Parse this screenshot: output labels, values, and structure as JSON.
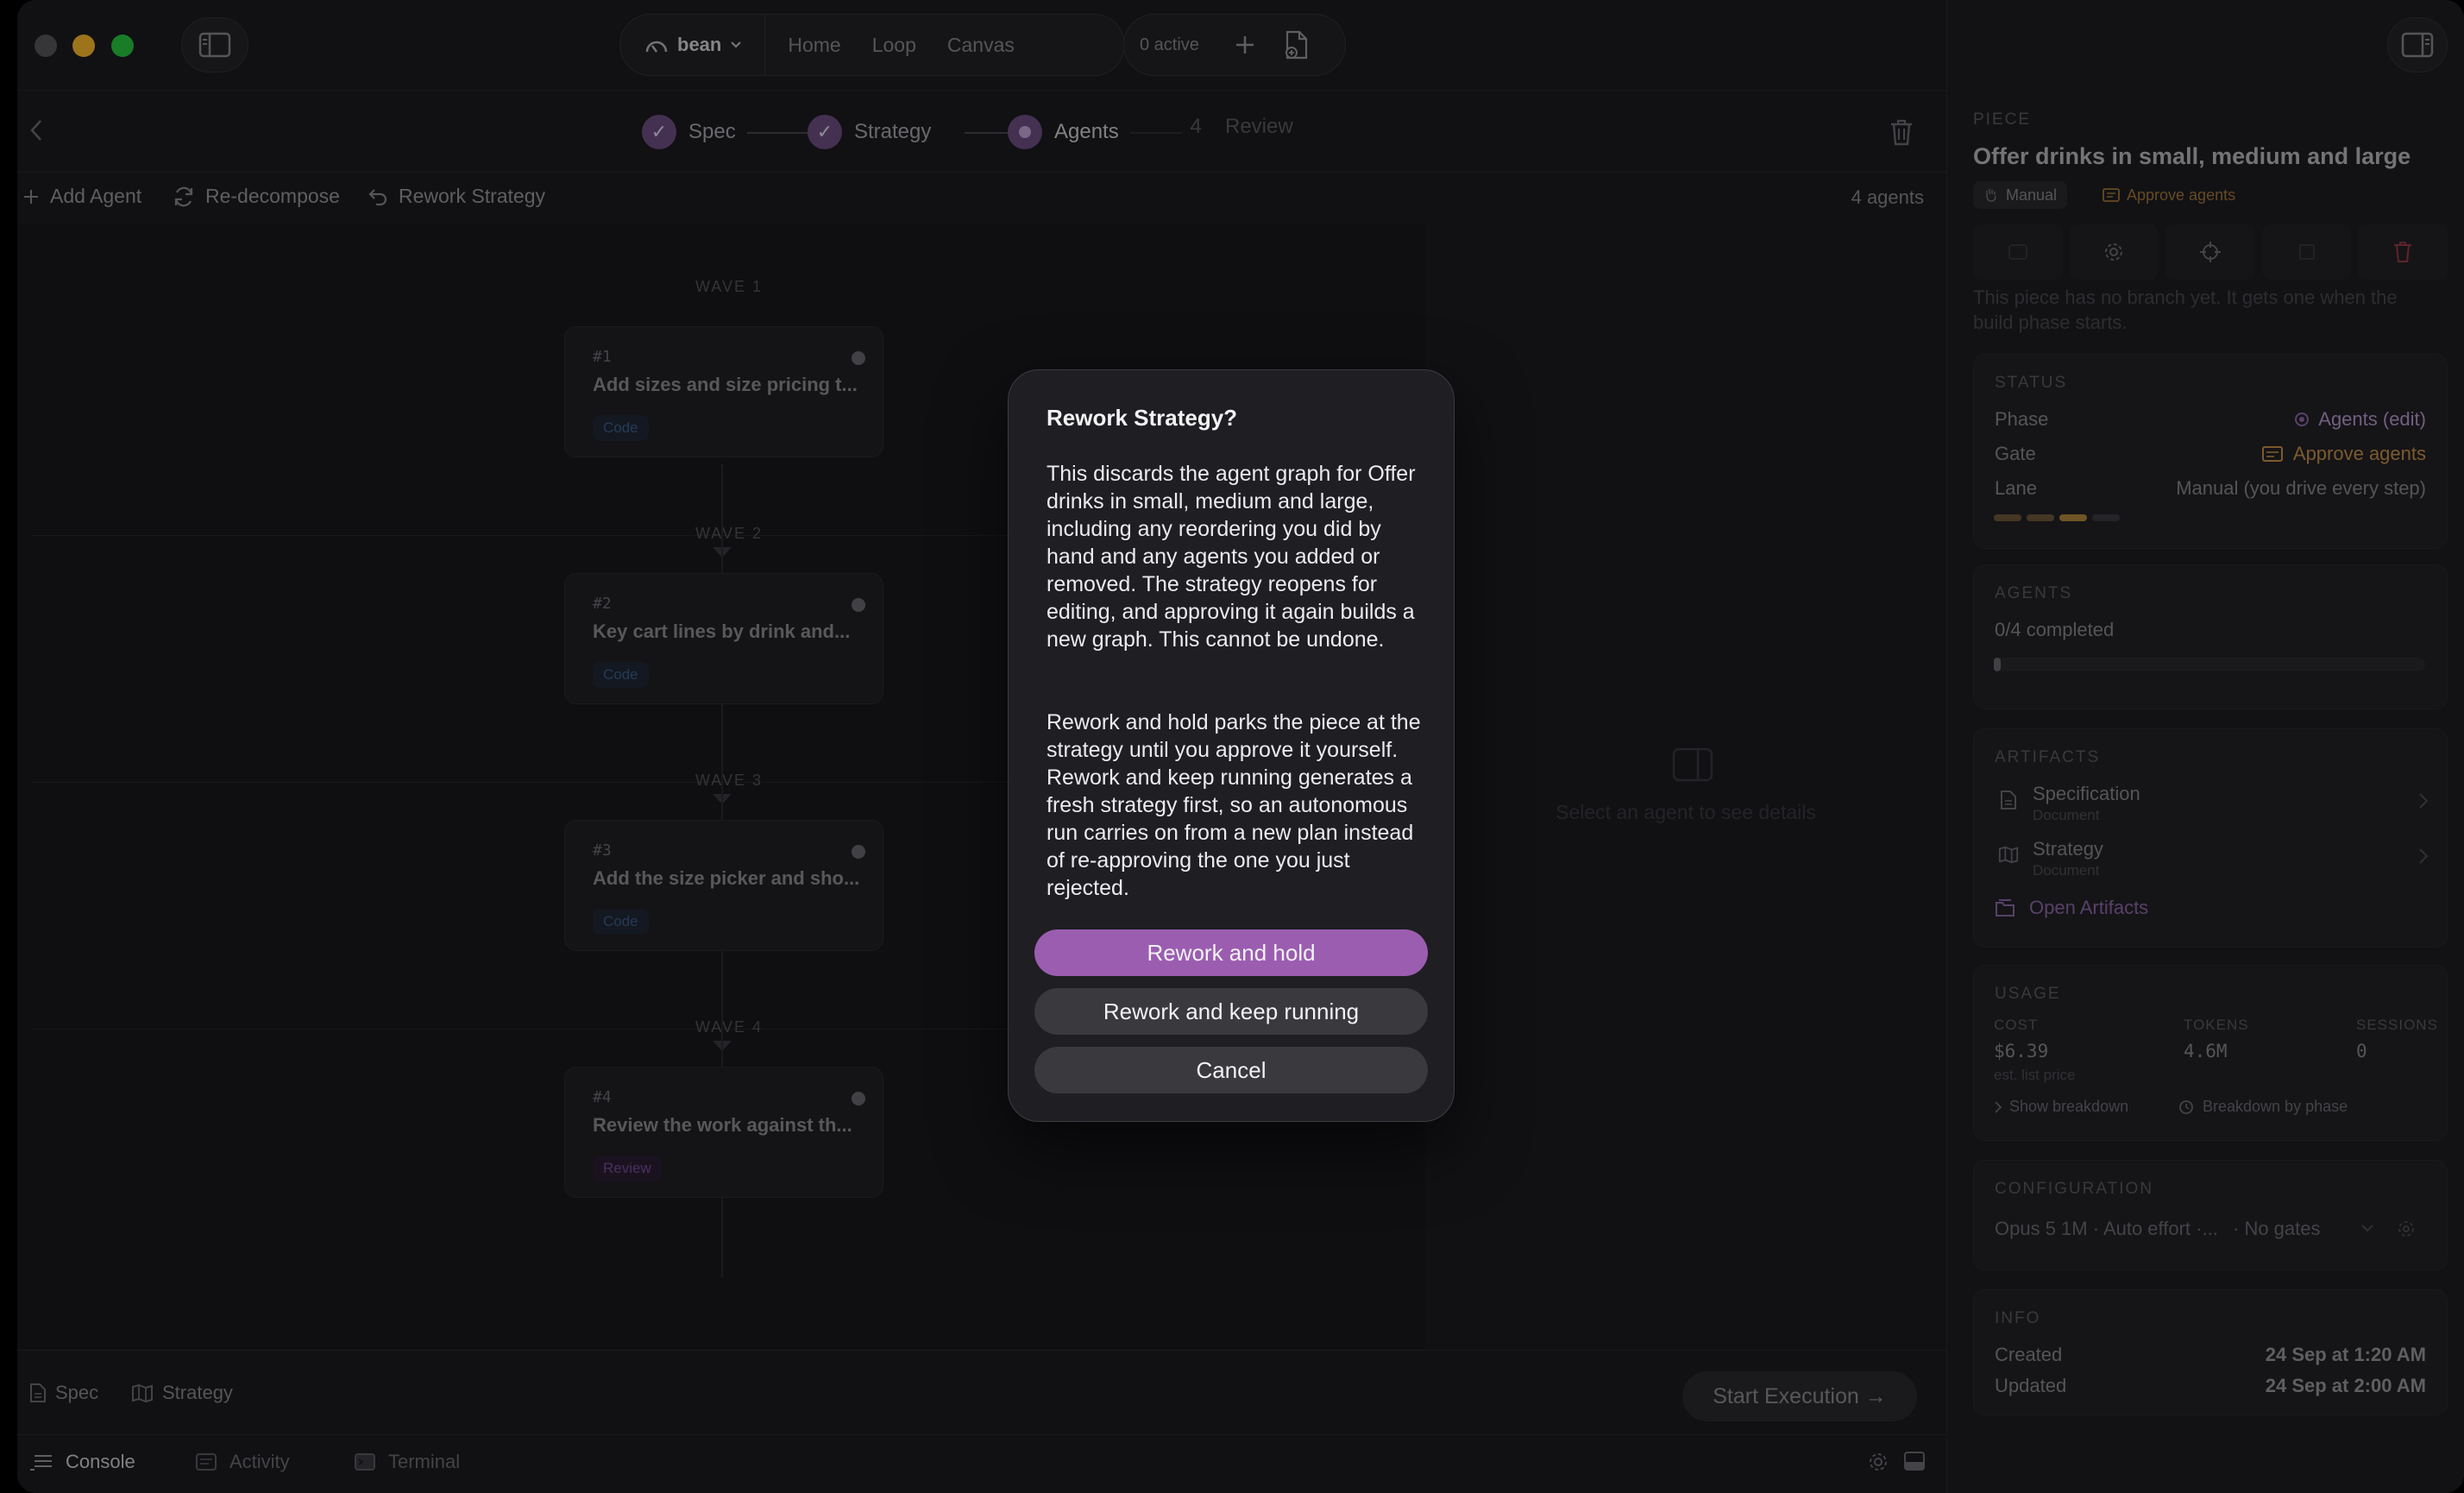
{
  "titlebar": {
    "workspace": "bean",
    "nav": [
      "Home",
      "Loop",
      "Canvas"
    ],
    "active_count": "0 active"
  },
  "stepper": {
    "steps": [
      {
        "label": "Spec",
        "state": "done"
      },
      {
        "label": "Strategy",
        "state": "done"
      },
      {
        "label": "Agents",
        "state": "current"
      },
      {
        "num": "4",
        "label": "Review",
        "state": "pending"
      }
    ]
  },
  "toolbar": {
    "add_agent": "Add Agent",
    "redecompose": "Re-decompose",
    "rework_strategy": "Rework Strategy",
    "agent_count": "4 agents"
  },
  "graph": {
    "waves": [
      "WAVE 1",
      "WAVE 2",
      "WAVE 3",
      "WAVE 4"
    ],
    "agents": [
      {
        "num": "#1",
        "title": "Add sizes and size pricing t...",
        "tag": "Code"
      },
      {
        "num": "#2",
        "title": "Key cart lines by drink and...",
        "tag": "Code"
      },
      {
        "num": "#3",
        "title": "Add the size picker and sho...",
        "tag": "Code"
      },
      {
        "num": "#4",
        "title": "Review the work against th...",
        "tag": "Review"
      }
    ],
    "detail_hint": "Select an agent to see details"
  },
  "footer": {
    "spec": "Spec",
    "strategy": "Strategy",
    "start": "Start Execution →"
  },
  "bottombar": {
    "tabs": [
      "Console",
      "Activity",
      "Terminal"
    ]
  },
  "panel": {
    "piece_label": "PIECE",
    "title": "Offer drinks in small, medium and large",
    "badge_manual": "Manual",
    "badge_gate": "Approve agents",
    "note": "This piece has no branch yet. It gets one when the build phase starts.",
    "status": {
      "label": "STATUS",
      "phase_k": "Phase",
      "phase_v": "Agents (edit)",
      "gate_k": "Gate",
      "gate_v": "Approve agents",
      "lane_k": "Lane",
      "lane_v": "Manual (you drive every step)"
    },
    "agents": {
      "label": "AGENTS",
      "completed": "0/4 completed",
      "progress": 0
    },
    "artifacts": {
      "label": "ARTIFACTS",
      "items": [
        {
          "name": "Specification",
          "type": "Document"
        },
        {
          "name": "Strategy",
          "type": "Document"
        }
      ],
      "open": "Open Artifacts"
    },
    "usage": {
      "label": "USAGE",
      "cost_h": "COST",
      "cost_v": "$6.39",
      "cost_note": "est. list price",
      "tokens_h": "TOKENS",
      "tokens_v": "4.6M",
      "sessions_h": "SESSIONS",
      "sessions_v": "0",
      "show_breakdown": "Show breakdown",
      "by_phase": "Breakdown by phase"
    },
    "config": {
      "label": "CONFIGURATION",
      "model": "Opus 5 1M · Auto effort ·...",
      "gates": "· No gates"
    },
    "info": {
      "label": "INFO",
      "created_k": "Created",
      "created_v": "24 Sep at 1:20 AM",
      "updated_k": "Updated",
      "updated_v": "24 Sep at 2:00 AM"
    }
  },
  "dialog": {
    "title": "Rework Strategy?",
    "para1": "This discards the agent graph for Offer drinks in small, medium and large, including any reordering you did by hand and any agents you added or removed. The strategy reopens for editing, and approving it again builds a new graph. This cannot be undone.",
    "para2": "Rework and hold parks the piece at the strategy until you approve it yourself. Rework and keep running generates a fresh strategy first, so an autonomous run carries on from a new plan instead of re-approving the one you just rejected.",
    "primary": "Rework and hold",
    "secondary": "Rework and keep running",
    "cancel": "Cancel"
  },
  "colors": {
    "accent": "#9b5db0",
    "gate": "#c9934a",
    "phase": "#b79ad0"
  }
}
